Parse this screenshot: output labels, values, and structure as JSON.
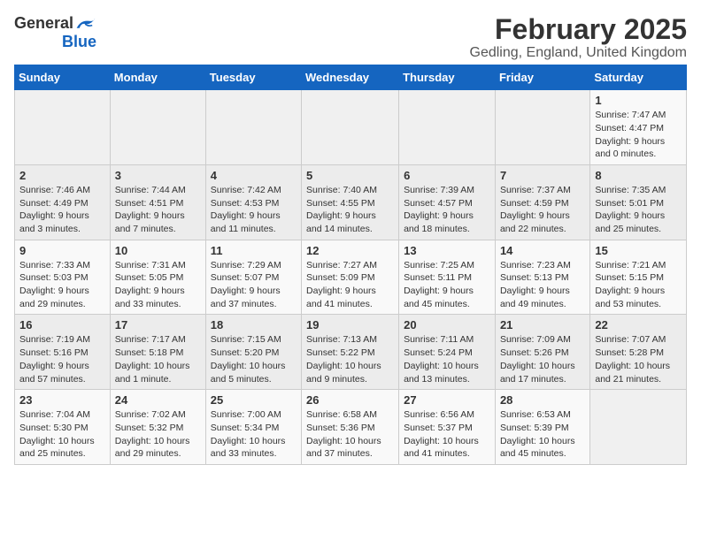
{
  "app": {
    "logo_general": "General",
    "logo_blue": "Blue"
  },
  "header": {
    "title": "February 2025",
    "subtitle": "Gedling, England, United Kingdom"
  },
  "calendar": {
    "days_of_week": [
      "Sunday",
      "Monday",
      "Tuesday",
      "Wednesday",
      "Thursday",
      "Friday",
      "Saturday"
    ],
    "weeks": [
      [
        {
          "day": "",
          "info": ""
        },
        {
          "day": "",
          "info": ""
        },
        {
          "day": "",
          "info": ""
        },
        {
          "day": "",
          "info": ""
        },
        {
          "day": "",
          "info": ""
        },
        {
          "day": "",
          "info": ""
        },
        {
          "day": "1",
          "info": "Sunrise: 7:47 AM\nSunset: 4:47 PM\nDaylight: 9 hours and 0 minutes."
        }
      ],
      [
        {
          "day": "2",
          "info": "Sunrise: 7:46 AM\nSunset: 4:49 PM\nDaylight: 9 hours and 3 minutes."
        },
        {
          "day": "3",
          "info": "Sunrise: 7:44 AM\nSunset: 4:51 PM\nDaylight: 9 hours and 7 minutes."
        },
        {
          "day": "4",
          "info": "Sunrise: 7:42 AM\nSunset: 4:53 PM\nDaylight: 9 hours and 11 minutes."
        },
        {
          "day": "5",
          "info": "Sunrise: 7:40 AM\nSunset: 4:55 PM\nDaylight: 9 hours and 14 minutes."
        },
        {
          "day": "6",
          "info": "Sunrise: 7:39 AM\nSunset: 4:57 PM\nDaylight: 9 hours and 18 minutes."
        },
        {
          "day": "7",
          "info": "Sunrise: 7:37 AM\nSunset: 4:59 PM\nDaylight: 9 hours and 22 minutes."
        },
        {
          "day": "8",
          "info": "Sunrise: 7:35 AM\nSunset: 5:01 PM\nDaylight: 9 hours and 25 minutes."
        }
      ],
      [
        {
          "day": "9",
          "info": "Sunrise: 7:33 AM\nSunset: 5:03 PM\nDaylight: 9 hours and 29 minutes."
        },
        {
          "day": "10",
          "info": "Sunrise: 7:31 AM\nSunset: 5:05 PM\nDaylight: 9 hours and 33 minutes."
        },
        {
          "day": "11",
          "info": "Sunrise: 7:29 AM\nSunset: 5:07 PM\nDaylight: 9 hours and 37 minutes."
        },
        {
          "day": "12",
          "info": "Sunrise: 7:27 AM\nSunset: 5:09 PM\nDaylight: 9 hours and 41 minutes."
        },
        {
          "day": "13",
          "info": "Sunrise: 7:25 AM\nSunset: 5:11 PM\nDaylight: 9 hours and 45 minutes."
        },
        {
          "day": "14",
          "info": "Sunrise: 7:23 AM\nSunset: 5:13 PM\nDaylight: 9 hours and 49 minutes."
        },
        {
          "day": "15",
          "info": "Sunrise: 7:21 AM\nSunset: 5:15 PM\nDaylight: 9 hours and 53 minutes."
        }
      ],
      [
        {
          "day": "16",
          "info": "Sunrise: 7:19 AM\nSunset: 5:16 PM\nDaylight: 9 hours and 57 minutes."
        },
        {
          "day": "17",
          "info": "Sunrise: 7:17 AM\nSunset: 5:18 PM\nDaylight: 10 hours and 1 minute."
        },
        {
          "day": "18",
          "info": "Sunrise: 7:15 AM\nSunset: 5:20 PM\nDaylight: 10 hours and 5 minutes."
        },
        {
          "day": "19",
          "info": "Sunrise: 7:13 AM\nSunset: 5:22 PM\nDaylight: 10 hours and 9 minutes."
        },
        {
          "day": "20",
          "info": "Sunrise: 7:11 AM\nSunset: 5:24 PM\nDaylight: 10 hours and 13 minutes."
        },
        {
          "day": "21",
          "info": "Sunrise: 7:09 AM\nSunset: 5:26 PM\nDaylight: 10 hours and 17 minutes."
        },
        {
          "day": "22",
          "info": "Sunrise: 7:07 AM\nSunset: 5:28 PM\nDaylight: 10 hours and 21 minutes."
        }
      ],
      [
        {
          "day": "23",
          "info": "Sunrise: 7:04 AM\nSunset: 5:30 PM\nDaylight: 10 hours and 25 minutes."
        },
        {
          "day": "24",
          "info": "Sunrise: 7:02 AM\nSunset: 5:32 PM\nDaylight: 10 hours and 29 minutes."
        },
        {
          "day": "25",
          "info": "Sunrise: 7:00 AM\nSunset: 5:34 PM\nDaylight: 10 hours and 33 minutes."
        },
        {
          "day": "26",
          "info": "Sunrise: 6:58 AM\nSunset: 5:36 PM\nDaylight: 10 hours and 37 minutes."
        },
        {
          "day": "27",
          "info": "Sunrise: 6:56 AM\nSunset: 5:37 PM\nDaylight: 10 hours and 41 minutes."
        },
        {
          "day": "28",
          "info": "Sunrise: 6:53 AM\nSunset: 5:39 PM\nDaylight: 10 hours and 45 minutes."
        },
        {
          "day": "",
          "info": ""
        }
      ]
    ]
  }
}
